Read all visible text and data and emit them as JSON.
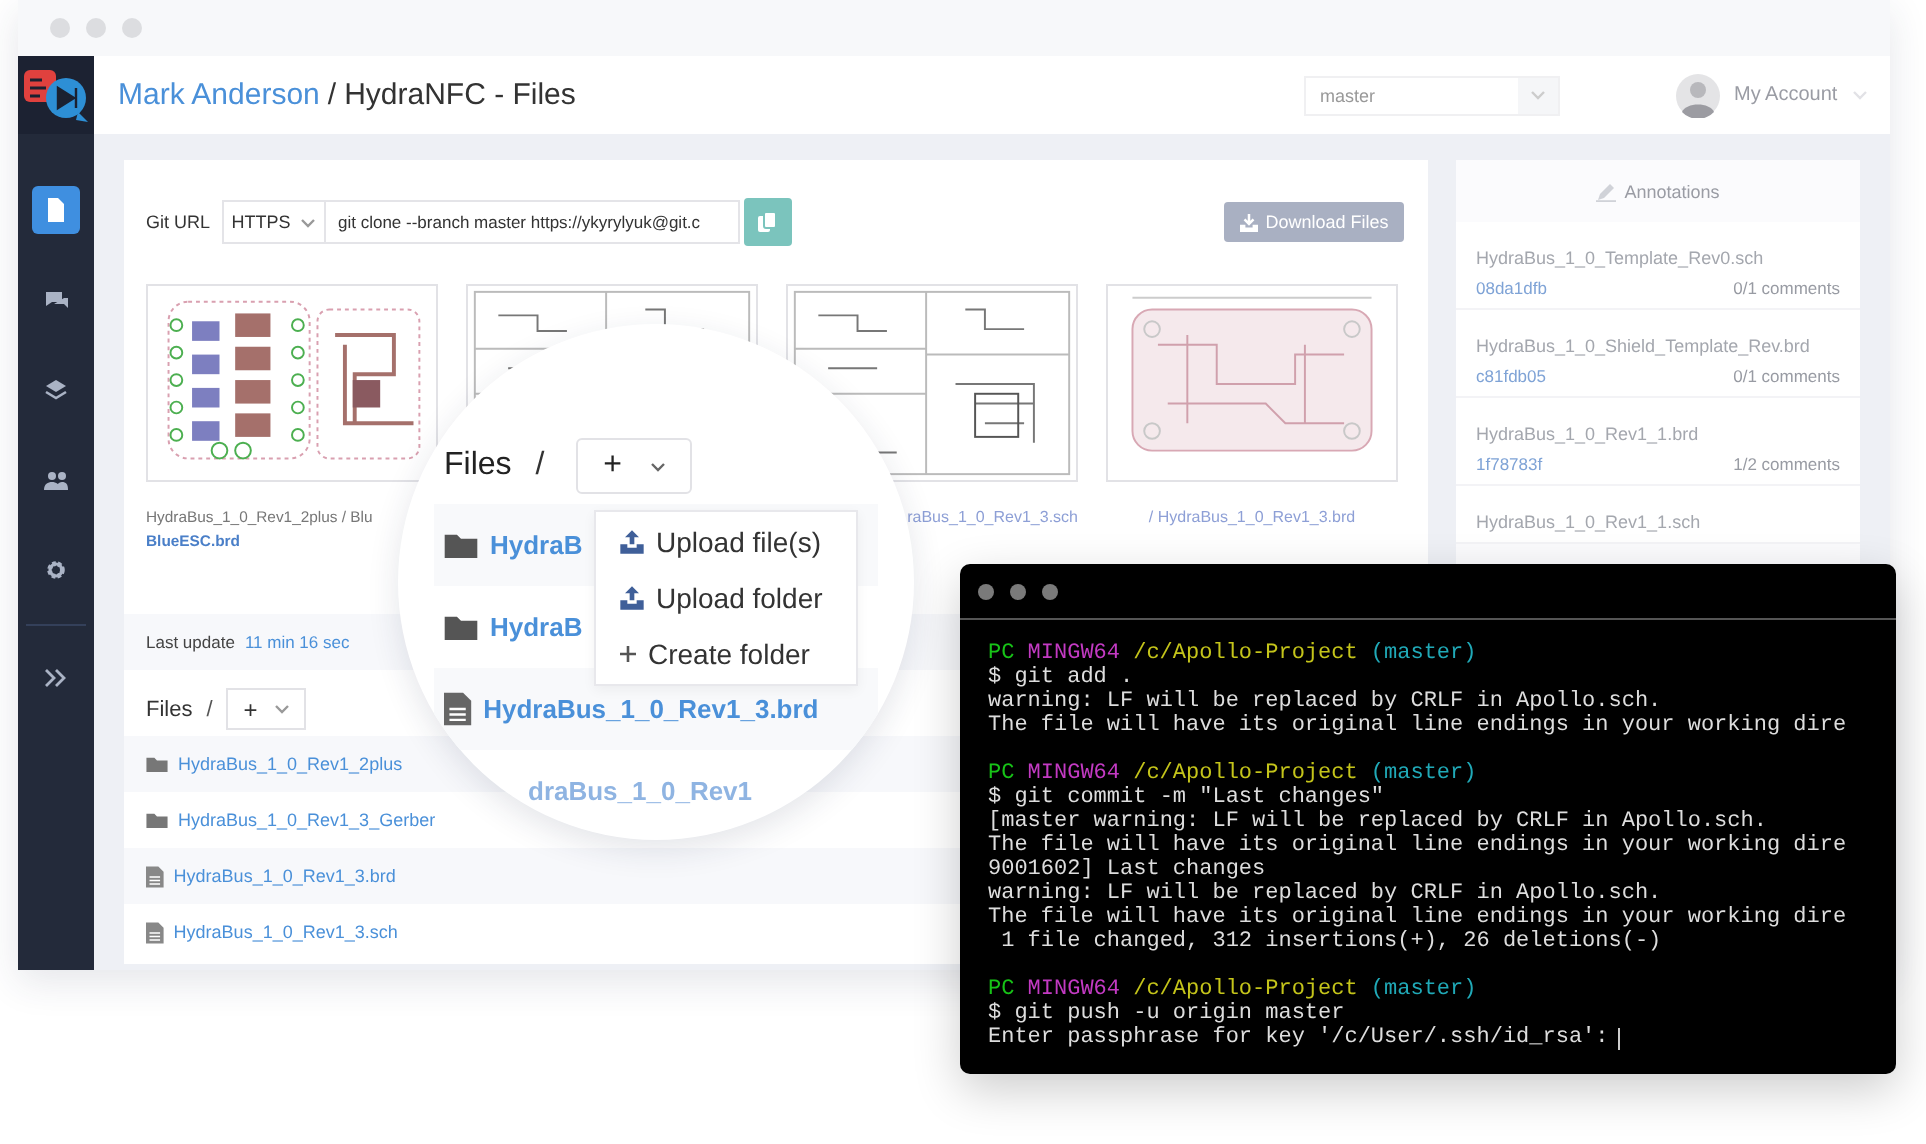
{
  "sidebar": {
    "items": [
      {
        "kind": "files",
        "selected": true
      },
      {
        "kind": "chat",
        "selected": false
      },
      {
        "kind": "layers",
        "selected": false
      },
      {
        "kind": "users",
        "selected": false
      },
      {
        "kind": "settings",
        "selected": false
      }
    ]
  },
  "header": {
    "owner": "Mark Anderson",
    "separator": "/",
    "title": "HydraNFC - Files",
    "branch": "master",
    "account": "My Account"
  },
  "git": {
    "label": "Git URL",
    "protocol": "HTTPS",
    "url": "git clone --branch master https://ykyrylyuk@git.c",
    "download": "Download Files"
  },
  "thumbnails": [
    {
      "kind": "board",
      "caption": "HydraBus_1_0_Rev1_2plus / Blu",
      "file": "BlueESC.brd"
    },
    {
      "kind": "schematic"
    },
    {
      "kind": "schematic",
      "caption": "raBus_1_0_Rev1_3.sch"
    },
    {
      "kind": "outline",
      "caption": "/ HydraBus_1_0_Rev1_3.brd"
    }
  ],
  "last_update": {
    "label": "Last update",
    "value": "11 min 16 sec"
  },
  "files": {
    "title": "Files",
    "separator": "/",
    "add": "+",
    "rows": [
      {
        "kind": "folder",
        "name": "HydraBus_1_0_Rev1_2plus"
      },
      {
        "kind": "folder",
        "name": "HydraBus_1_0_Rev1_3_Gerber"
      },
      {
        "kind": "file",
        "name": "HydraBus_1_0_Rev1_3.brd"
      },
      {
        "kind": "file",
        "name": "HydraBus_1_0_Rev1_3.sch"
      }
    ]
  },
  "magnifier": {
    "title": "Files",
    "separator": "/",
    "add": "+",
    "menu": [
      {
        "kind": "upload",
        "label": "Upload file(s)"
      },
      {
        "kind": "upload",
        "label": "Upload folder"
      },
      {
        "kind": "create",
        "label": "Create folder"
      }
    ],
    "rows": [
      {
        "kind": "folder",
        "name": "HydraB"
      },
      {
        "kind": "folder",
        "name": "HydraB"
      },
      {
        "kind": "file",
        "name": "HydraBus_1_0_Rev1_3.brd"
      },
      {
        "kind": "faded",
        "name": "draBus_1_0_Rev1"
      }
    ]
  },
  "annotations": {
    "title": "Annotations",
    "items": [
      {
        "file": "HydraBus_1_0_Template_Rev0.sch",
        "commit": "08da1dfb",
        "comments": "0/1 comments"
      },
      {
        "file": "HydraBus_1_0_Shield_Template_Rev.brd",
        "commit": "c81fdb05",
        "comments": "0/1 comments"
      },
      {
        "file": "HydraBus_1_0_Rev1_1.brd",
        "commit": "1f78783f",
        "comments": "1/2 comments"
      },
      {
        "file": "HydraBus_1_0_Rev1_1.sch"
      }
    ]
  },
  "terminal": {
    "blocks": [
      {
        "prompt": {
          "user": "PC",
          "host": "MINGW64",
          "path": "/c/Apollo-Project",
          "branch": "(master)"
        },
        "lines": [
          "$ git add .",
          "warning: LF will be replaced by CRLF in Apollo.sch.",
          "The file will have its original line endings in your working dire"
        ]
      },
      {
        "prompt": {
          "user": "PC",
          "host": "MINGW64",
          "path": "/c/Apollo-Project",
          "branch": "(master)"
        },
        "lines": [
          "$ git commit -m \"Last changes\"",
          "[master warning: LF will be replaced by CRLF in Apollo.sch.",
          "The file will have its original line endings in your working dire",
          "9001602] Last changes",
          "warning: LF will be replaced by CRLF in Apollo.sch.",
          "The file will have its original line endings in your working dire",
          " 1 file changed, 312 insertions(+), 26 deletions(-)"
        ]
      },
      {
        "prompt": {
          "user": "PC",
          "host": "MINGW64",
          "path": "/c/Apollo-Project",
          "branch": "(master)"
        },
        "lines": [
          "$ git push -u origin master",
          "Enter passphrase for key '/c/User/.ssh/id_rsa':"
        ],
        "cursor": true
      }
    ]
  }
}
